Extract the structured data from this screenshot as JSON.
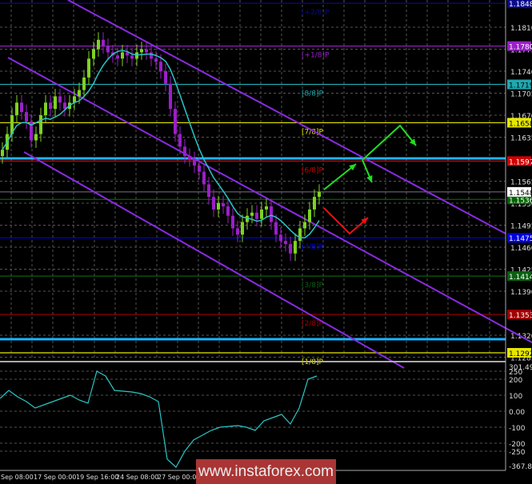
{
  "chart_data": {
    "type": "candlestick",
    "symbol_price_scale": {
      "ticks": [
        1.181,
        1.1775,
        1.174,
        1.1705,
        1.167,
        1.1635,
        1.1565,
        1.153,
        1.1495,
        1.146,
        1.1425,
        1.139,
        1.132,
        1.1285
      ],
      "range": [
        1.1285,
        1.1848
      ]
    },
    "closes": [
      1.1615,
      1.164,
      1.167,
      1.169,
      1.1675,
      1.166,
      1.163,
      1.164,
      1.167,
      1.169,
      1.168,
      1.17,
      1.169,
      1.168,
      1.169,
      1.17,
      1.171,
      1.173,
      1.176,
      1.1775,
      1.179,
      1.178,
      1.177,
      1.1765,
      1.176,
      1.177,
      1.1765,
      1.176,
      1.177,
      1.1775,
      1.177,
      1.176,
      1.1755,
      1.174,
      1.172,
      1.168,
      1.164,
      1.162,
      1.1605,
      1.16,
      1.159,
      1.158,
      1.156,
      1.154,
      1.152,
      1.153,
      1.1525,
      1.151,
      1.149,
      1.148,
      1.15,
      1.151,
      1.1515,
      1.1505,
      1.152,
      1.1525,
      1.15,
      1.148,
      1.147,
      1.1465,
      1.145,
      1.147,
      1.149,
      1.15,
      1.152,
      1.154,
      1.1548
    ],
    "current_price": 1.1548,
    "levels": [
      {
        "price": 1.1848,
        "label": "[+2/8]P",
        "tag": "1.1848",
        "color": "#0a0a8a"
      },
      {
        "price": 1.178,
        "label": "[+1/8]P",
        "tag": "1.1780",
        "color": "#9b1fc9"
      },
      {
        "price": 1.1719,
        "label": "[8/8]P",
        "tag": "1.1719",
        "color": "#1fa8b0"
      },
      {
        "price": 1.1658,
        "label": "[7/8]P",
        "tag": "1.1658",
        "color": "#e6e600"
      },
      {
        "price": 1.1597,
        "label": "[6/8]P",
        "tag": "1.1597",
        "color": "#d00000"
      },
      {
        "price": 1.1536,
        "label": "",
        "tag": "1.1536",
        "color": "#006400"
      },
      {
        "price": 1.1475,
        "label": "[4/8]P",
        "tag": "1.1475",
        "color": "#0000e0"
      },
      {
        "price": 1.1414,
        "label": "[3/8]P",
        "tag": "1.1414",
        "color": "#0a6010"
      },
      {
        "price": 1.1353,
        "label": "[2/8]P",
        "tag": "1.1353",
        "color": "#a00000"
      },
      {
        "price": 1.1292,
        "label": "[1/8]P",
        "tag": "1.1292",
        "color": "#e6e600"
      }
    ],
    "x_tick_labels": [
      "Sep 08:00",
      "17 Sep 00:00",
      "19 Sep 16:00",
      "24 Sep 08:00",
      "27 Sep 00:00"
    ],
    "oscillator": {
      "max_label": "301.498",
      "min_label": "-367.870",
      "ticks": [
        "250",
        "200",
        "100",
        "0.00",
        "-100",
        "-200",
        "-250"
      ],
      "tick_values": [
        250,
        200,
        100,
        0,
        -100,
        -200,
        -250
      ],
      "values": [
        80,
        130,
        90,
        60,
        20,
        40,
        60,
        80,
        100,
        70,
        50,
        250,
        220,
        130,
        125,
        120,
        110,
        90,
        60,
        -300,
        -350,
        -250,
        -180,
        -150,
        -120,
        -100,
        -95,
        -90,
        -100,
        -120,
        -60,
        -40,
        -20,
        -80,
        20,
        200,
        220
      ]
    },
    "colors": {
      "bull": "#7fd320",
      "bear": "#9b1fc9",
      "ma": "#2ac6c6",
      "channel": "#8a2be2",
      "cyan_lines": "#1eb4ff"
    }
  },
  "watermark": "www.instaforex.com"
}
